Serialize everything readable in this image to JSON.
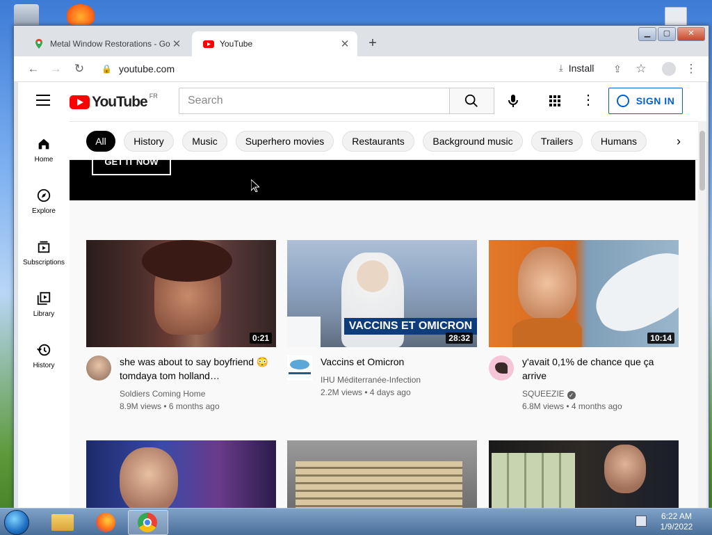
{
  "browser": {
    "tabs": [
      {
        "title": "Metal Window Restorations - Go",
        "active": false
      },
      {
        "title": "YouTube",
        "active": true
      }
    ],
    "url": "youtube.com",
    "install_label": "Install"
  },
  "youtube": {
    "logo_text": "YouTube",
    "country_code": "FR",
    "search_placeholder": "Search",
    "sign_in_label": "SIGN IN",
    "guide": [
      {
        "label": "Home"
      },
      {
        "label": "Explore"
      },
      {
        "label": "Subscriptions"
      },
      {
        "label": "Library"
      },
      {
        "label": "History"
      }
    ],
    "chips": [
      "All",
      "History",
      "Music",
      "Superhero movies",
      "Restaurants",
      "Background music",
      "Trailers",
      "Humans"
    ],
    "selected_chip": "All",
    "banner_cta": "GET IT NOW",
    "videos": [
      {
        "title": "she was about to say boyfriend 😳 tomdaya tom holland…",
        "channel": "Soldiers Coming Home",
        "views": "8.9M views",
        "age": "6 months ago",
        "duration": "0:21",
        "verified": false
      },
      {
        "title": "Vaccins et Omicron",
        "channel": "IHU Méditerranée-Infection",
        "views": "2.2M views",
        "age": "4 days ago",
        "duration": "28:32",
        "verified": false,
        "thumb_caption": "VACCINS ET OMICRON"
      },
      {
        "title": "y'avait 0,1% de chance que ça arrive",
        "channel": "SQUEEZIE",
        "views": "6.8M views",
        "age": "4 months ago",
        "duration": "10:14",
        "verified": true
      }
    ]
  },
  "taskbar": {
    "time": "6:22 AM",
    "date": "1/9/2022"
  }
}
